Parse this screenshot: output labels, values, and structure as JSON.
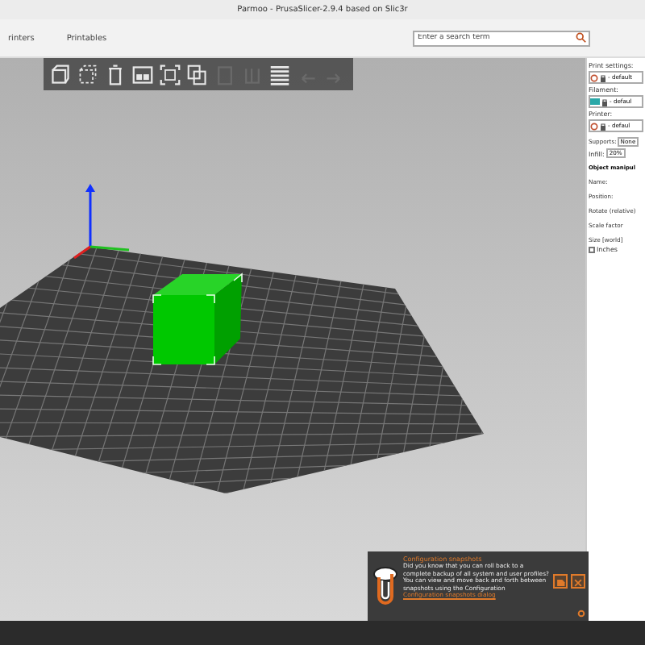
{
  "window": {
    "title": "Parmoo - PrusaSlicer-2.9.4 based on Slic3r"
  },
  "tabs": [
    {
      "label": "rinters",
      "selected": false
    },
    {
      "label": "Printables",
      "selected": false
    }
  ],
  "search": {
    "placeholder": "Enter a search term"
  },
  "toolbar": [
    {
      "disabled": false
    },
    {
      "disabled": false
    },
    {
      "disabled": false
    },
    {
      "disabled": false
    },
    {
      "disabled": false
    },
    {
      "disabled": false
    },
    {
      "disabled": true
    },
    {
      "disabled": true
    },
    {
      "disabled": false
    },
    {
      "disabled": true
    },
    {
      "disabled": true
    }
  ],
  "sidebar": {
    "presets": [
      {
        "label": "Print settings:",
        "value": "- default"
      },
      {
        "label": "Filament:",
        "value": "- defaul",
        "color": "#2aa8a8"
      },
      {
        "label": "Printer:",
        "value": "- defaul"
      }
    ],
    "supports": {
      "label": "Supports:",
      "value": "None"
    },
    "infill": {
      "label": "Infill:",
      "value": "20%"
    },
    "object_manipulation": {
      "title": "Object manipul",
      "fields": [
        "Name:",
        "Position:",
        "Rotate (relative)",
        "Scale factor",
        "Size [world]"
      ],
      "inches": {
        "label": "Inches",
        "checked": false
      }
    }
  },
  "notification": {
    "title": "Configuration snapshots",
    "body": "Did you know that you can roll back to a complete backup of all system and user profiles? You can view and move back and forth between snapshots using the Configuration",
    "link": "Configuration snapshots dialog"
  }
}
